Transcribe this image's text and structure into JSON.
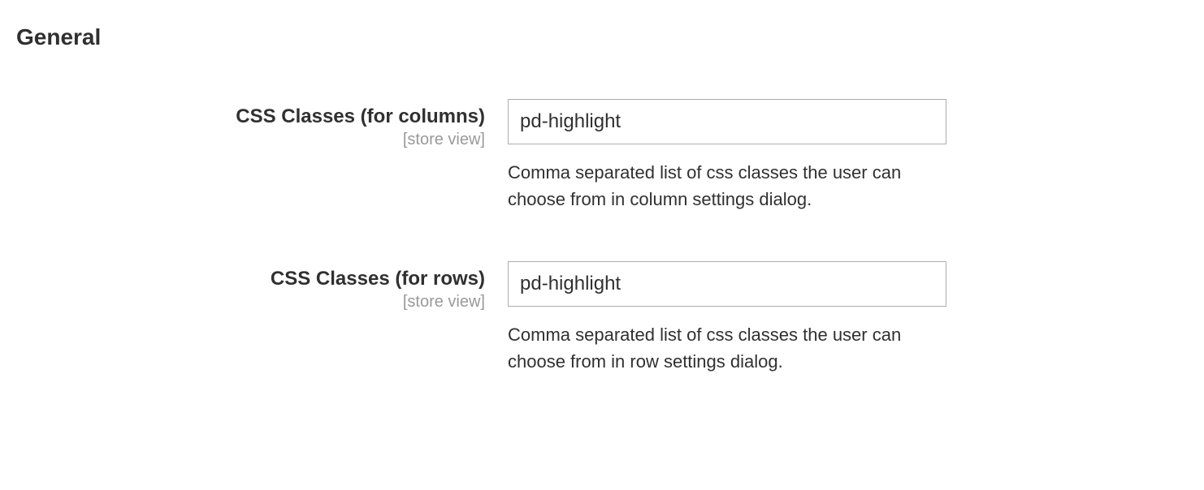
{
  "section": {
    "title": "General"
  },
  "fields": {
    "columns": {
      "label": "CSS Classes (for columns)",
      "scope": "[store view]",
      "value": "pd-highlight",
      "note": "Comma separated list of css classes the user can choose from in column settings dialog."
    },
    "rows": {
      "label": "CSS Classes (for rows)",
      "scope": "[store view]",
      "value": "pd-highlight",
      "note": "Comma separated list of css classes the user can choose from in row settings dialog."
    }
  }
}
